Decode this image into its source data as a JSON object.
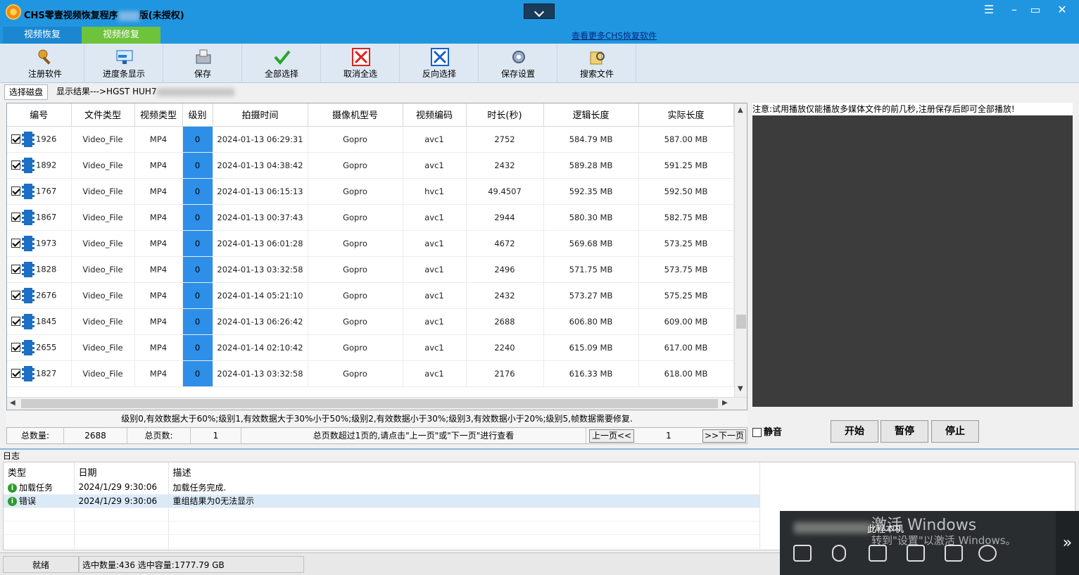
{
  "app": {
    "title_prefix": "CHS零壹视频恢复程序",
    "title_suffix": "版(未授权)"
  },
  "mode_tabs": [
    "视频恢复",
    "视频修复"
  ],
  "more_link": "查看更多CHS恢复软件",
  "toolbar": [
    "注册软件",
    "进度条显示",
    "保存",
    "全部选择",
    "取消全选",
    "反向选择",
    "保存设置",
    "搜索文件"
  ],
  "data_tabs": {
    "disk": "选择磁盘",
    "result": "显示结果--->HGST HUH7"
  },
  "grid": {
    "columns": [
      "编号",
      "文件类型",
      "视频类型",
      "级别",
      "拍摄时间",
      "摄像机型号",
      "视频编码",
      "时长(秒)",
      "逻辑长度",
      "实际长度"
    ],
    "rows": [
      [
        "1926",
        "Video_File",
        "MP4",
        "0",
        "2024-01-13 06:29:31",
        "Gopro",
        "avc1",
        "2752",
        "584.79 MB",
        "587.00 MB"
      ],
      [
        "1892",
        "Video_File",
        "MP4",
        "0",
        "2024-01-13 04:38:42",
        "Gopro",
        "avc1",
        "2432",
        "589.28 MB",
        "591.25 MB"
      ],
      [
        "1767",
        "Video_File",
        "MP4",
        "0",
        "2024-01-13 06:15:13",
        "Gopro",
        "hvc1",
        "49.4507",
        "592.35 MB",
        "592.50 MB"
      ],
      [
        "1867",
        "Video_File",
        "MP4",
        "0",
        "2024-01-13 00:37:43",
        "Gopro",
        "avc1",
        "2944",
        "580.30 MB",
        "582.75 MB"
      ],
      [
        "1973",
        "Video_File",
        "MP4",
        "0",
        "2024-01-13 06:01:28",
        "Gopro",
        "avc1",
        "4672",
        "569.68 MB",
        "573.25 MB"
      ],
      [
        "1828",
        "Video_File",
        "MP4",
        "0",
        "2024-01-13 03:32:58",
        "Gopro",
        "avc1",
        "2496",
        "571.75 MB",
        "573.75 MB"
      ],
      [
        "2676",
        "Video_File",
        "MP4",
        "0",
        "2024-01-14 05:21:10",
        "Gopro",
        "avc1",
        "2432",
        "573.27 MB",
        "575.25 MB"
      ],
      [
        "1845",
        "Video_File",
        "MP4",
        "0",
        "2024-01-13 06:26:42",
        "Gopro",
        "avc1",
        "2688",
        "606.80 MB",
        "609.00 MB"
      ],
      [
        "2655",
        "Video_File",
        "MP4",
        "0",
        "2024-01-14 02:10:42",
        "Gopro",
        "avc1",
        "2240",
        "615.09 MB",
        "617.00 MB"
      ],
      [
        "1827",
        "Video_File",
        "MP4",
        "0",
        "2024-01-13 03:32:58",
        "Gopro",
        "avc1",
        "2176",
        "616.33 MB",
        "618.00 MB"
      ]
    ]
  },
  "legend": "级别0,有效数据大于60%;级别1,有效数据大于30%小于50%;级别2,有效数据小于30%;级别3,有效数据小于20%;级别5,帧数据需要修复.",
  "pager": {
    "total_label": "总数量:",
    "total": "2688",
    "pages_label": "总页数:",
    "pages": "1",
    "hint": "总页数超过1页的,请点击\"上一页\"或\"下一页\"进行查看",
    "prev": "上一页<<",
    "current": "1",
    "next": ">>下一页"
  },
  "player": {
    "notice": "注意:试用播放仅能播放多媒体文件的前几秒,注册保存后即可全部播放!",
    "mute": "静音",
    "start": "开始",
    "pause": "暂停",
    "stop": "停止"
  },
  "log": {
    "title": "日志",
    "columns": [
      "类型",
      "日期",
      "描述"
    ],
    "rows": [
      {
        "type": "加载任务",
        "date": "2024/1/29 9:30:06",
        "desc": "加载任务完成."
      },
      {
        "type": "错误",
        "date": "2024/1/29 9:30:06",
        "desc": "重组结果为0无法显示"
      }
    ]
  },
  "status": {
    "state": "就绪",
    "selection": "选中数量:436 选中容量:1777.79 GB"
  },
  "overlay": {
    "tag": "此程本机",
    "watermark_title": "激活 Windows",
    "watermark_sub": "转到\"设置\"以激活 Windows。"
  }
}
